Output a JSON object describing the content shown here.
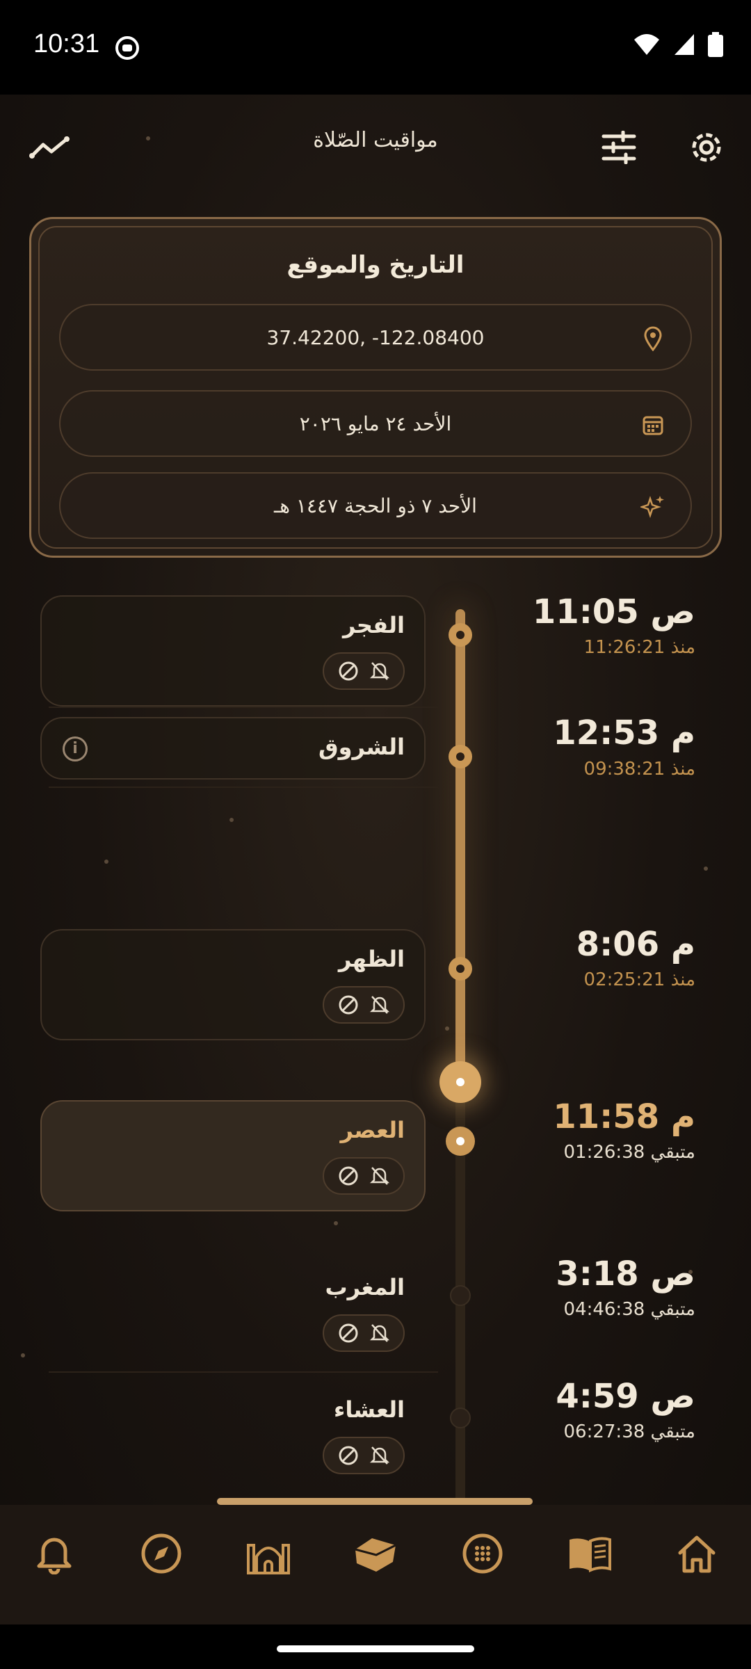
{
  "status_bar": {
    "time": "10:31"
  },
  "header": {
    "title": "مواقيت الصّلاة"
  },
  "date_card": {
    "title": "التاريخ والموقع",
    "location": "37.42200, -122.08400",
    "gregorian_date": "الأحد ٢٤ مايو ٢٠٢٦",
    "hijri_date": "الأحد ٧ ذو الحجة ١٤٤٧ هـ"
  },
  "prayers": [
    {
      "name": "الفجر",
      "time": "11:05 ص",
      "relative": "منذ 11:26:21"
    },
    {
      "name": "الشروق",
      "time": "12:53 م",
      "relative": "منذ 09:38:21"
    },
    {
      "name": "الظهر",
      "time": "8:06 م",
      "relative": "منذ 02:25:21"
    },
    {
      "name": "العصر",
      "time": "11:58 م",
      "relative": "متبقي 01:26:38"
    },
    {
      "name": "المغرب",
      "time": "3:18 ص",
      "relative": "متبقي 04:46:38"
    },
    {
      "name": "العشاء",
      "time": "4:59 ص",
      "relative": "متبقي 06:27:38"
    }
  ],
  "nav": [
    "bell-icon",
    "compass-icon",
    "mosque-icon",
    "kaaba-icon",
    "tasbih-icon",
    "quran-icon",
    "home-icon"
  ],
  "colors": {
    "accent": "#c99755",
    "background": "#1a1410",
    "text": "#efe6d6"
  }
}
